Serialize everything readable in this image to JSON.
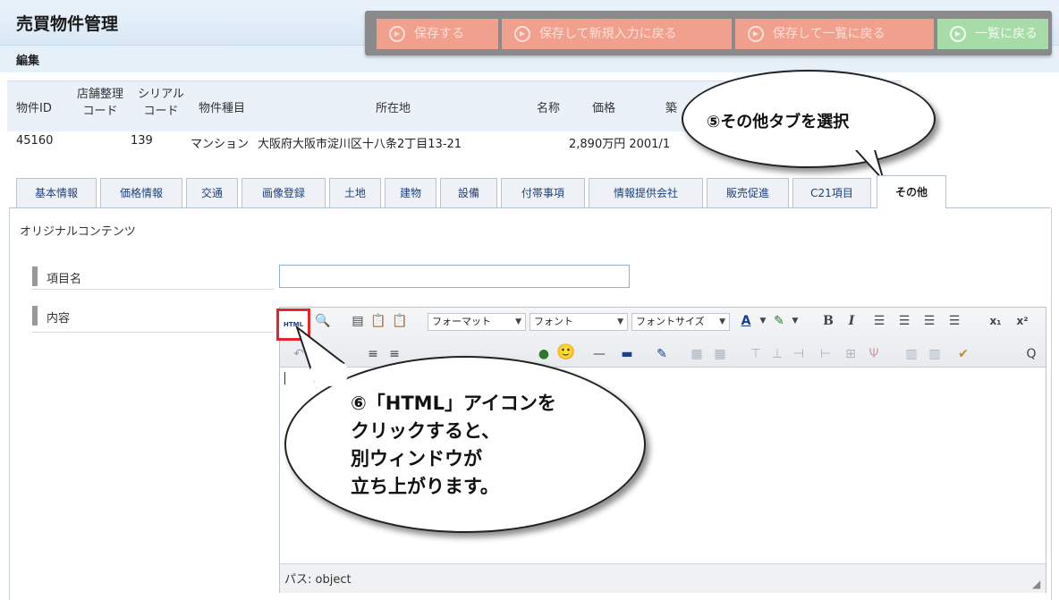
{
  "header": {
    "title": "売買物件管理",
    "subtitle": "編集"
  },
  "actions": [
    {
      "label": "保存する",
      "icon": "arrow-circle-icon",
      "color": "#f0a08d"
    },
    {
      "label": "保存して新規入力に戻る",
      "icon": "arrow-circle-icon",
      "color": "#f0a08d"
    },
    {
      "label": "保存して一覧に戻る",
      "icon": "arrow-circle-icon",
      "color": "#f0a08d"
    },
    {
      "label": "一覧に戻る",
      "icon": "arrow-circle-icon",
      "color": "#a7dba8"
    }
  ],
  "info": {
    "headers": {
      "id": "物件ID",
      "store_code_1": "店舗整理",
      "store_code_2": "コード",
      "serial_1": "シリアル",
      "serial_2": "コード",
      "type": "物件種目",
      "location": "所在地",
      "name": "名称",
      "price": "価格",
      "built": "築"
    },
    "row": {
      "id": "45160",
      "serial": "139",
      "type": "マンション",
      "location": "大阪府大阪市淀川区十八条2丁目13-21",
      "price_built": "2,890万円 2001/1"
    }
  },
  "callouts": {
    "tab_select": "⑤その他タブを選択",
    "html_icon_line1": "⑥「HTML」アイコンを",
    "html_icon_line2": "クリックすると、",
    "html_icon_line3": "別ウィンドウが",
    "html_icon_line4": "立ち上がります。"
  },
  "tabs": [
    "基本情報",
    "価格情報",
    "交通",
    "画像登録",
    "土地",
    "建物",
    "設備",
    "付帯事項",
    "情報提供会社",
    "販売促進",
    "C21項目",
    "その他"
  ],
  "active_tab": "その他",
  "content": {
    "section_label": "オリジナルコンテンツ",
    "item_name_label": "項目名",
    "item_name_value": "",
    "content_label": "内容"
  },
  "editor": {
    "format_select": "フォーマット",
    "font_select": "フォント",
    "size_select": "フォントサイズ",
    "html_icon_text": "HTML",
    "path_status": "パス: object"
  },
  "colors": {
    "header_bg": "#d9e8f5",
    "highlight": "#e3262b",
    "active_tab_bg": "#ffffff"
  }
}
